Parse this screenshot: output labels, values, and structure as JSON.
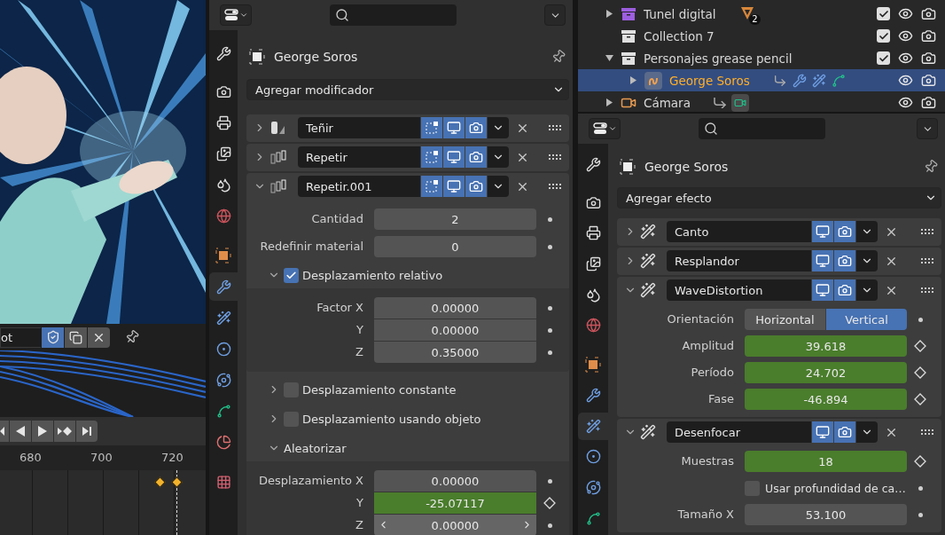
{
  "viewport": {
    "datablock_field": "ot",
    "fake_user": true
  },
  "timeline": {
    "frame_ticks": [
      "680",
      "700",
      "720"
    ]
  },
  "outliner": {
    "rows": [
      {
        "kind": "collection",
        "name": "Tunel digital",
        "color": "#9d5ee0",
        "expanded": false,
        "selected": false,
        "checked": true,
        "badge": "2"
      },
      {
        "kind": "collection",
        "name": "Collection 7",
        "color": "#e0e0e0",
        "selected": false,
        "checked": true
      },
      {
        "kind": "collection",
        "name": "Personajes grease pencil",
        "color": "#e0e0e0",
        "expanded": true,
        "selected": false,
        "checked": true,
        "children": [
          {
            "kind": "grease_pencil",
            "name": "George Soros",
            "expanded": false,
            "selected": true
          }
        ]
      },
      {
        "kind": "camera",
        "name": "Cámara",
        "expanded": false,
        "selected": false
      }
    ]
  },
  "modifier_properties": {
    "object_name": "George Soros",
    "add_menu": "Agregar modificador",
    "tabs": [
      {
        "kind": "tool",
        "selected": false
      },
      {
        "kind": "render",
        "selected": false
      },
      {
        "kind": "output",
        "selected": false
      },
      {
        "kind": "view_layer",
        "selected": false
      },
      {
        "kind": "scene",
        "selected": false
      },
      {
        "kind": "world",
        "selected": false
      },
      {
        "kind": "object",
        "selected": false
      },
      {
        "kind": "modifiers",
        "selected": true
      },
      {
        "kind": "effects",
        "selected": false
      },
      {
        "kind": "physics",
        "selected": false
      },
      {
        "kind": "constraints",
        "selected": false
      },
      {
        "kind": "data",
        "selected": false
      },
      {
        "kind": "material",
        "selected": false
      },
      {
        "kind": "texture",
        "selected": false
      }
    ],
    "items": [
      {
        "kind": "tint",
        "name": "Teñir",
        "expanded": false,
        "toggles": [
          {
            "kind": "edit_mode",
            "on": true
          },
          {
            "kind": "viewport",
            "on": true
          },
          {
            "kind": "render",
            "on": true
          }
        ]
      },
      {
        "kind": "array",
        "name": "Repetir",
        "expanded": false,
        "toggles": [
          {
            "kind": "edit_mode",
            "on": true
          },
          {
            "kind": "viewport",
            "on": true
          },
          {
            "kind": "render",
            "on": true
          }
        ]
      },
      {
        "kind": "array",
        "name": "Repetir.001",
        "expanded": true,
        "toggles": [
          {
            "kind": "edit_mode",
            "on": true
          },
          {
            "kind": "viewport",
            "on": true
          },
          {
            "kind": "render",
            "on": true
          }
        ],
        "rows": [
          {
            "kind": "number",
            "label": "Cantidad",
            "value": "2",
            "keyed": false,
            "hovered": false
          },
          {
            "kind": "number",
            "label": "Redefinir material",
            "value": "0",
            "keyed": false,
            "hovered": false
          },
          {
            "kind": "subpanel",
            "label": "Desplazamiento relativo",
            "expanded": true,
            "checked": true,
            "rows": [
              {
                "kind": "vector",
                "items": [
                  {
                    "label": "Factor X",
                    "value": "0.00000",
                    "keyed": false,
                    "hovered": false
                  },
                  {
                    "label": "Y",
                    "value": "0.00000",
                    "keyed": false,
                    "hovered": false
                  },
                  {
                    "label": "Z",
                    "value": "0.35000",
                    "keyed": false,
                    "hovered": false
                  }
                ]
              }
            ]
          },
          {
            "kind": "subpanel",
            "label": "Desplazamiento constante",
            "expanded": false,
            "checked": false
          },
          {
            "kind": "subpanel",
            "label": "Desplazamiento usando objeto",
            "expanded": false,
            "checked": false
          },
          {
            "kind": "subpanel",
            "label": "Aleatorizar",
            "expanded": true,
            "rows": [
              {
                "kind": "vector",
                "items": [
                  {
                    "label": "Desplazamiento X",
                    "value": "0.00000",
                    "keyed": false,
                    "hovered": false
                  },
                  {
                    "label": "Y",
                    "value": "-25.07117",
                    "keyed": true,
                    "hovered": false
                  },
                  {
                    "label": "Z",
                    "value": "0.00000",
                    "keyed": false,
                    "hovered": true
                  }
                ]
              }
            ]
          }
        ]
      }
    ]
  },
  "effect_properties": {
    "object_name": "George Soros",
    "add_menu": "Agregar efecto",
    "tabs": [
      {
        "kind": "tool",
        "selected": false
      },
      {
        "kind": "render",
        "selected": false
      },
      {
        "kind": "output",
        "selected": false
      },
      {
        "kind": "view_layer",
        "selected": false
      },
      {
        "kind": "scene",
        "selected": false
      },
      {
        "kind": "world",
        "selected": false
      },
      {
        "kind": "object",
        "selected": false
      },
      {
        "kind": "modifiers",
        "selected": false
      },
      {
        "kind": "effects",
        "selected": true
      },
      {
        "kind": "physics",
        "selected": false
      },
      {
        "kind": "constraints",
        "selected": false
      },
      {
        "kind": "data",
        "selected": false
      }
    ],
    "items": [
      {
        "kind": "fx",
        "name": "Canto",
        "expanded": false,
        "toggles": [
          {
            "kind": "viewport",
            "on": true
          },
          {
            "kind": "render",
            "on": true
          }
        ]
      },
      {
        "kind": "fx",
        "name": "Resplandor",
        "expanded": false,
        "toggles": [
          {
            "kind": "viewport",
            "on": true
          },
          {
            "kind": "render",
            "on": true
          }
        ]
      },
      {
        "kind": "fx",
        "name": "WaveDistortion",
        "expanded": true,
        "toggles": [
          {
            "kind": "viewport",
            "on": true
          },
          {
            "kind": "render",
            "on": true
          }
        ],
        "rows": [
          {
            "kind": "enum",
            "label": "Orientación",
            "options": [
              {
                "label": "Horizontal",
                "selected": false
              },
              {
                "label": "Vertical",
                "selected": true
              }
            ]
          },
          {
            "kind": "number",
            "label": "Amplitud",
            "value": "39.618",
            "keyed": true,
            "hovered": false
          },
          {
            "kind": "number",
            "label": "Período",
            "value": "24.702",
            "keyed": true,
            "hovered": false
          },
          {
            "kind": "number",
            "label": "Fase",
            "value": "-46.894",
            "keyed": true,
            "hovered": false
          }
        ]
      },
      {
        "kind": "fx",
        "name": "Desenfocar",
        "expanded": true,
        "toggles": [
          {
            "kind": "viewport",
            "on": true
          },
          {
            "kind": "render",
            "on": true
          }
        ],
        "rows": [
          {
            "kind": "number",
            "label": "Muestras",
            "value": "18",
            "keyed": true,
            "hovered": false
          },
          {
            "kind": "checkbox",
            "label": "Usar profundidad de ca…",
            "checked": false
          },
          {
            "kind": "number",
            "label": "Tamaño X",
            "value": "53.100",
            "keyed": false,
            "hovered": false
          }
        ]
      }
    ]
  }
}
